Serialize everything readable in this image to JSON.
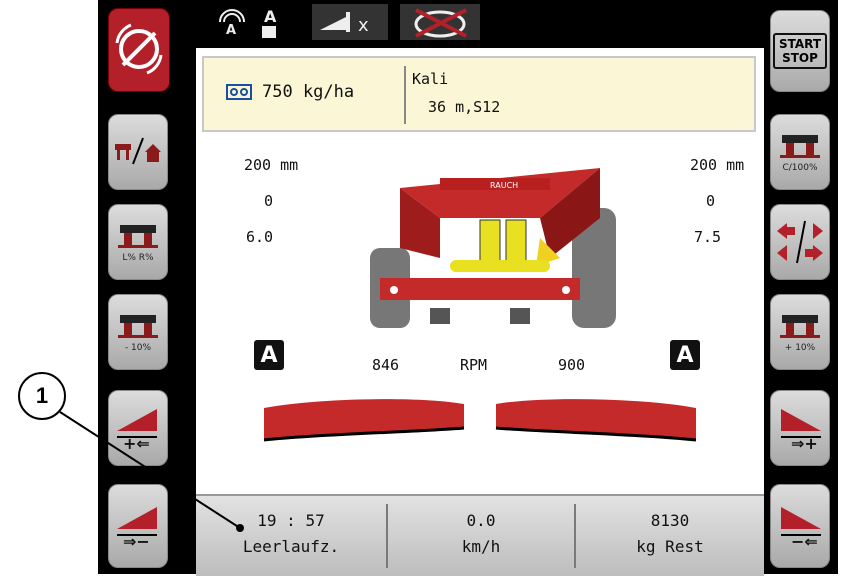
{
  "info": {
    "rate": "750 kg/ha",
    "fertilizer": "Kali",
    "width_setting": "36 m,S12"
  },
  "left_data": {
    "a": "200 mm",
    "b": "0",
    "c": "6.0"
  },
  "right_data": {
    "a": "200 mm",
    "b": "0",
    "c": "7.5"
  },
  "rpm": {
    "left_badge": "A",
    "left": "846",
    "label": "RPM",
    "right": "900",
    "right_badge": "A"
  },
  "left_buttons": {
    "b3_sub": "L% R%",
    "b4_sub": "- 10%"
  },
  "right_buttons": {
    "start_line1": "START",
    "start_line2": "STOP",
    "b2_sub": "C/100%",
    "b4_sub": "+ 10%"
  },
  "status": {
    "time": "19 : 57",
    "time_label": "Leerlaufz.",
    "speed": "0.0",
    "speed_label": "km/h",
    "rest": "8130",
    "rest_label": "kg Rest"
  },
  "callout": "1",
  "colors": {
    "accent_red": "#b3202a",
    "info_bg": "#fbf6d5"
  }
}
